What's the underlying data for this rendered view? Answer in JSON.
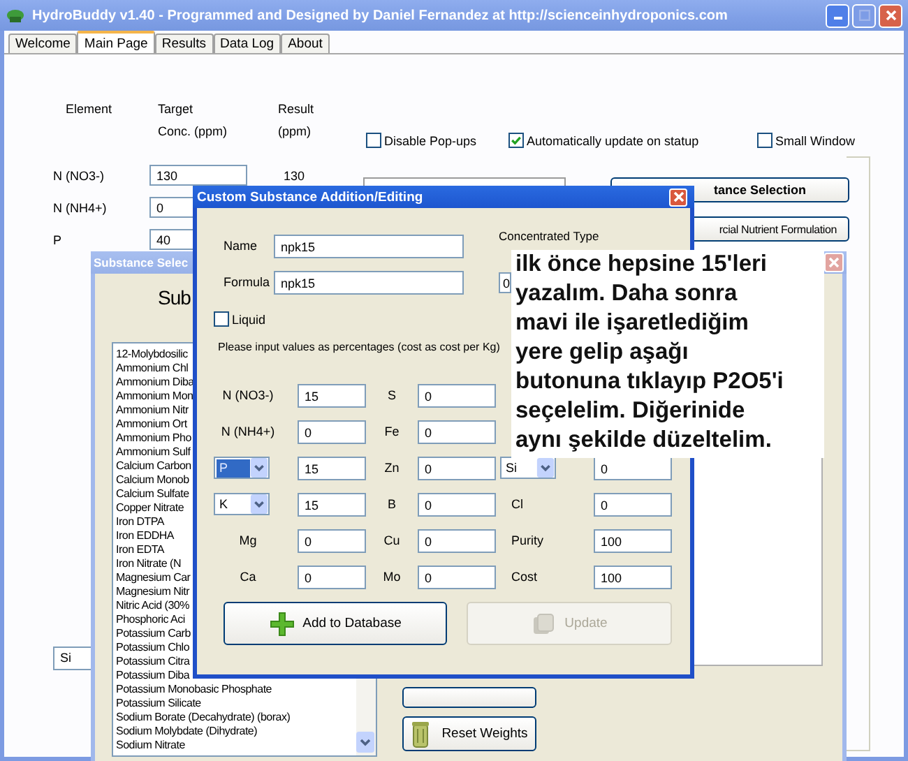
{
  "window": {
    "title": "HydroBuddy v1.40 - Programmed and Designed by Daniel Fernandez at http://scienceinhydroponics.com"
  },
  "tabs": [
    {
      "label": "Welcome",
      "selected": false
    },
    {
      "label": "Main Page",
      "selected": true
    },
    {
      "label": "Results",
      "selected": false
    },
    {
      "label": "Data Log",
      "selected": false
    },
    {
      "label": "About",
      "selected": false
    }
  ],
  "main_page": {
    "headers": [
      "Element",
      "Target\nConc. (ppm)",
      "Result\n(ppm)"
    ],
    "elements": [
      {
        "name": "N (NO3-)",
        "target": "130",
        "result": "130"
      },
      {
        "name": "N (NH4+)",
        "target": "0"
      },
      {
        "name": "P",
        "target": "40"
      }
    ],
    "options": [
      {
        "label": "Disable Pop-ups",
        "checked": false
      },
      {
        "label": "Automatically update on statup",
        "checked": true
      },
      {
        "label": "Small Window",
        "checked": false
      }
    ],
    "buttons": [
      {
        "label": "tance Selection",
        "kind": "bold"
      },
      {
        "label": "rcial Nutrient Formulation",
        "kind": "plain"
      }
    ],
    "bottom_field": {
      "value": "Si"
    }
  },
  "substance_selection": {
    "title": "Substance Selec",
    "heading": "Sub",
    "substances": [
      "12-Molybdosilic",
      "Ammonium Chl",
      "Ammonium Diba",
      "Ammonium Mon",
      "Ammonium Nitr",
      "Ammonium Ort",
      "Ammonium Pho",
      "Ammonium Sulf",
      "Calcium Carbon",
      "Calcium Monob",
      "Calcium Sulfate",
      "Copper Nitrate",
      "Iron DTPA",
      "Iron EDDHA",
      "Iron EDTA",
      "Iron Nitrate (N",
      "Magnesium Car",
      "Magnesium Nitr",
      "Nitric Acid (30%",
      "Phosphoric Aci",
      "Potassium Carb",
      "Potassium Chlo",
      "Potassium Citra",
      "Potassium Diba",
      "Potassium Monobasic Phosphate",
      "Potassium Silicate",
      "Sodium Borate (Decahydrate) (borax)",
      "Sodium Molybdate (Dihydrate)",
      "Sodium Nitrate"
    ],
    "reset_button": "Reset Weights"
  },
  "custom_dialog": {
    "title": "Custom Substance Addition/Editing",
    "name": {
      "label": "Name",
      "value": "npk15"
    },
    "formula": {
      "label": "Formula",
      "value": "npk15"
    },
    "concentrated_type": {
      "label": "Concentrated Type",
      "value": "0"
    },
    "liquid": {
      "label": "Liquid",
      "checked": false
    },
    "instructions": "Please input values as percentages (cost as cost per Kg)",
    "columns": [
      [
        {
          "kind": "label",
          "label": "N (NO3-)",
          "value": "15"
        },
        {
          "kind": "label",
          "label": "N (NH4+)",
          "value": "0"
        },
        {
          "kind": "select",
          "label": "P",
          "highlighted": true,
          "value": "15"
        },
        {
          "kind": "select",
          "label": "K",
          "highlighted": false,
          "value": "15"
        },
        {
          "kind": "label",
          "label": "Mg",
          "value": "0"
        },
        {
          "kind": "label",
          "label": "Ca",
          "value": "0"
        }
      ],
      [
        {
          "kind": "label",
          "label": "S",
          "value": "0"
        },
        {
          "kind": "label",
          "label": "Fe",
          "value": "0"
        },
        {
          "kind": "label",
          "label": "Zn",
          "value": "0"
        },
        {
          "kind": "label",
          "label": "B",
          "value": "0"
        },
        {
          "kind": "label",
          "label": "Cu",
          "value": "0"
        },
        {
          "kind": "label",
          "label": "Mo",
          "value": "0"
        }
      ],
      [
        {
          "kind": "select",
          "label": "Si",
          "highlighted": false,
          "value": "0"
        },
        {
          "kind": "label",
          "label": "Cl",
          "value": "0"
        },
        {
          "kind": "label",
          "label": "Purity",
          "value": "100"
        },
        {
          "kind": "label",
          "label": "Cost",
          "value": "100"
        }
      ]
    ],
    "buttons": [
      {
        "label": "Add to Database",
        "kind": "add",
        "disabled": false
      },
      {
        "label": "Update",
        "kind": "update",
        "disabled": true
      }
    ]
  },
  "annotation": {
    "text": "ilk önce hepsine 15'leri\nyazalım. Daha sonra\nmavi ile işaretlediğim\nyere gelip aşağı\nbutonuna tıklayıp P2O5'i\nseçelelim. Diğerinide\naynı şekilde düzeltelim."
  }
}
